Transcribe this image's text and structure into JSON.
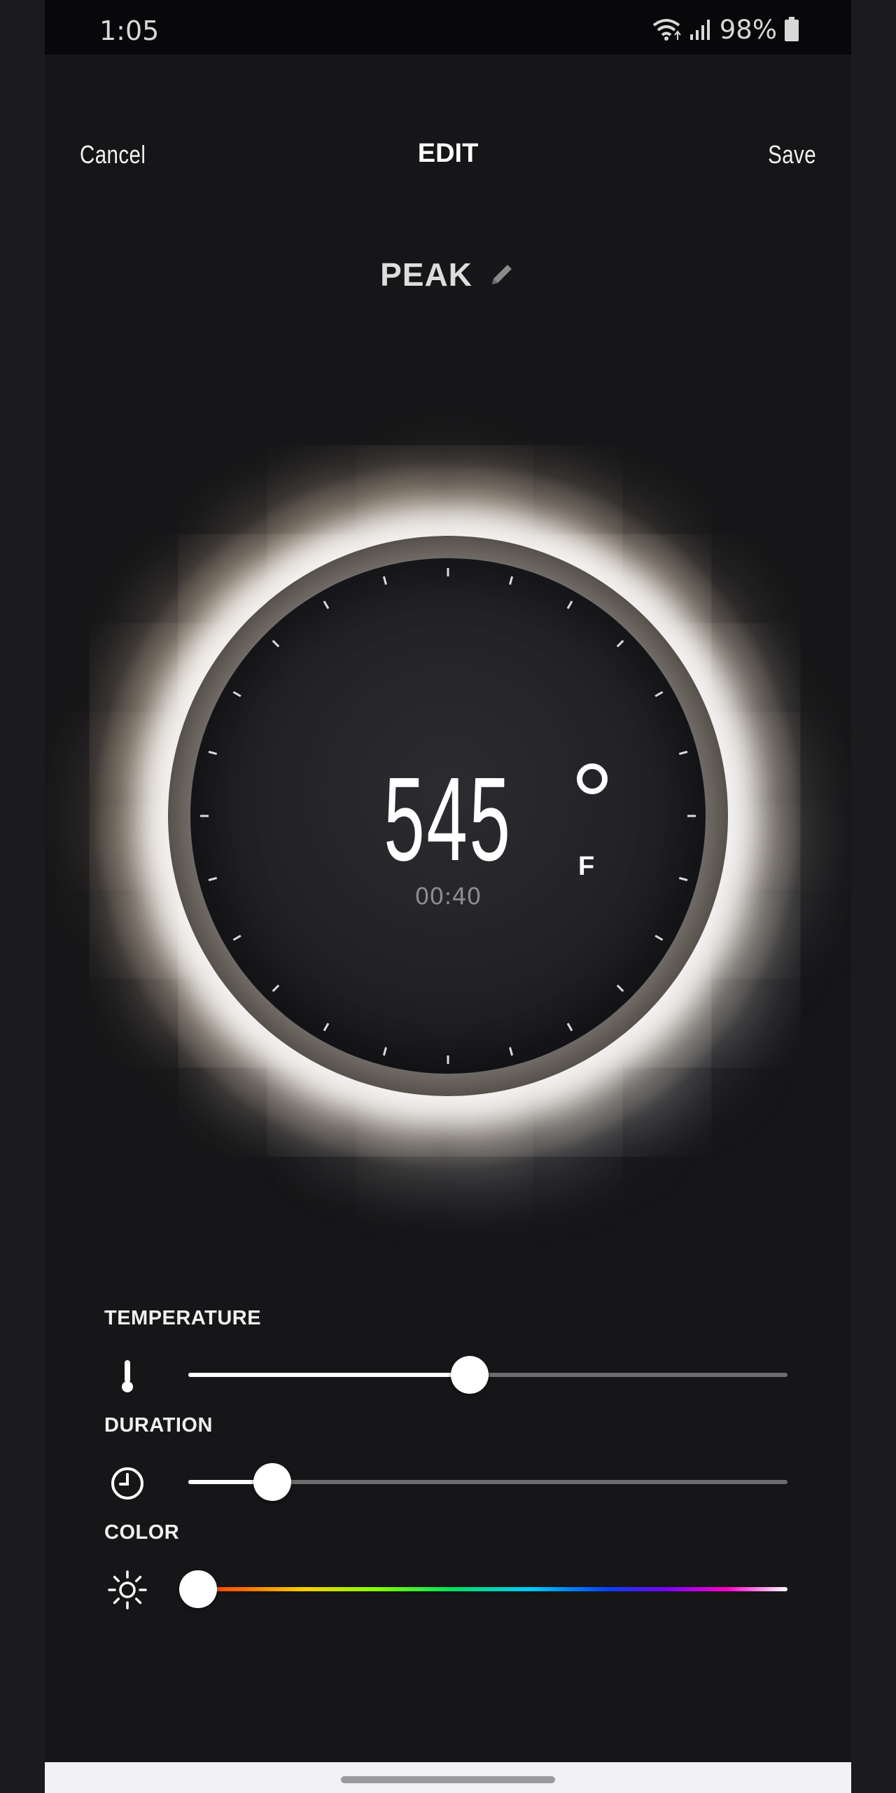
{
  "status_bar": {
    "time": "1:05",
    "battery": "98%",
    "icons": [
      "wifi-icon",
      "signal-icon",
      "battery-icon"
    ]
  },
  "header": {
    "cancel_label": "Cancel",
    "title": "EDIT",
    "save_label": "Save"
  },
  "preset": {
    "name": "PEAK",
    "edit_icon": "pencil-icon"
  },
  "dial": {
    "temperature": "545",
    "unit": "F",
    "timer": "00:40"
  },
  "controls": {
    "temperature": {
      "label": "TEMPERATURE",
      "icon": "thermometer-icon",
      "value_fraction": 0.47
    },
    "duration": {
      "label": "DURATION",
      "icon": "clock-icon",
      "value_fraction": 0.14
    },
    "color": {
      "label": "COLOR",
      "icon": "sun-icon",
      "value_fraction": 0.0
    }
  },
  "colors": {
    "background": "#161618",
    "accent": "#ffffff",
    "track_inactive": "#6d6d70"
  }
}
